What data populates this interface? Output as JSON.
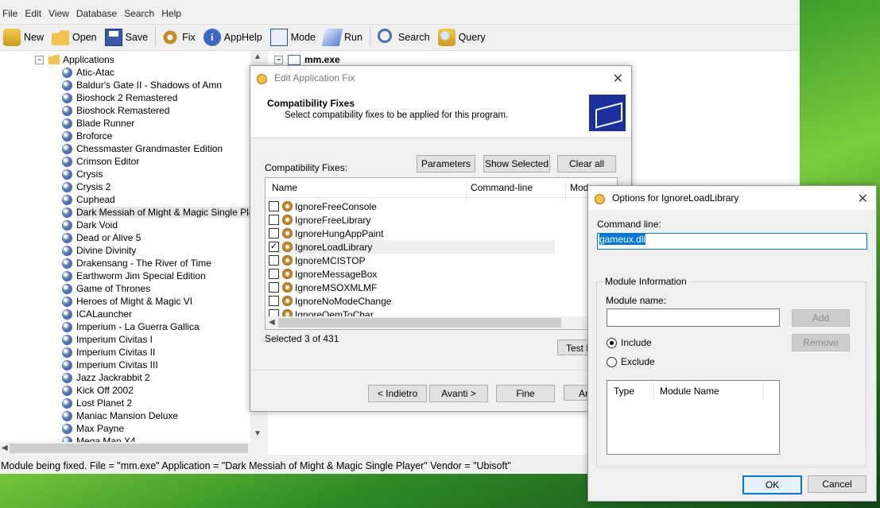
{
  "menu": [
    "File",
    "Edit",
    "View",
    "Database",
    "Search",
    "Help"
  ],
  "toolbar": {
    "new": "New",
    "open": "Open",
    "save": "Save",
    "fix": "Fix",
    "apphelp": "AppHelp",
    "mode": "Mode",
    "run": "Run",
    "search": "Search",
    "query": "Query"
  },
  "tree": {
    "root_label": "Applications",
    "items": [
      "Atic-Atac",
      "Baldur's Gate II - Shadows of Amn",
      "Bioshock 2 Remastered",
      "Bioshock Remastered",
      "Blade Runner",
      "Broforce",
      "Chessmaster Grandmaster Edition",
      "Crimson Editor",
      "Crysis",
      "Crysis 2",
      "Cuphead",
      "Dark Messiah of Might & Magic Single Player",
      "Dark Void",
      "Dead or Alive 5",
      "Divine Divinity",
      "Drakensang - The River of Time",
      "Earthworm Jim Special Edition",
      "Game of Thrones",
      "Heroes of Might & Magic VI",
      "ICALauncher",
      "Imperium - La Guerra Gallica",
      "Imperium Civitas I",
      "Imperium Civitas II",
      "Imperium Civitas III",
      "Jazz Jackrabbit 2",
      "Kick Off 2002",
      "Lost Planet 2",
      "Maniac Mansion Deluxe",
      "Max Payne",
      "Mega Man X4"
    ],
    "selected_item": "Dark Messiah of Might & Magic Single Player"
  },
  "right_pane": {
    "node": "mm.exe"
  },
  "statusbar": "Module being fixed. File  = \"mm.exe\" Application = \"Dark Messiah of Might & Magic Single Player\" Vendor = \"Ubisoft\"",
  "edit_dialog": {
    "title": "Edit Application Fix",
    "header_title": "Compatibility Fixes",
    "header_subtitle": "Select compatibility fixes to be applied for this program.",
    "list_label": "Compatibility Fixes:",
    "buttons": {
      "parameters": "Parameters",
      "show_selected": "Show Selected",
      "clear_all": "Clear all",
      "test": "Test R",
      "back": "< Indietro",
      "next": "Avanti >",
      "finish": "Fine",
      "cancel": "An"
    },
    "columns": [
      "Name",
      "Command-line",
      "Modu"
    ],
    "fixes": [
      {
        "name": "IgnoreFreeConsole",
        "checked": false
      },
      {
        "name": "IgnoreFreeLibrary",
        "checked": false
      },
      {
        "name": "IgnoreHungAppPaint",
        "checked": false
      },
      {
        "name": "IgnoreLoadLibrary",
        "checked": true
      },
      {
        "name": "IgnoreMCISTOP",
        "checked": false
      },
      {
        "name": "IgnoreMessageBox",
        "checked": false
      },
      {
        "name": "IgnoreMSOXMLMF",
        "checked": false
      },
      {
        "name": "IgnoreNoModeChange",
        "checked": false
      },
      {
        "name": "IgnoreOemToChar",
        "checked": false
      }
    ],
    "selected_count": "Selected 3 of 431"
  },
  "options_dialog": {
    "title": "Options for IgnoreLoadLibrary",
    "command_line_label": "Command line:",
    "command_line_value": "gameux.dll",
    "module_group_label": "Module Information",
    "module_name_label": "Module name:",
    "module_name_value": "",
    "add": "Add",
    "remove": "Remove",
    "include": "Include",
    "exclude": "Exclude",
    "include_selected": true,
    "list_columns": [
      "Type",
      "Module Name"
    ],
    "ok": "OK",
    "cancel": "Cancel"
  }
}
